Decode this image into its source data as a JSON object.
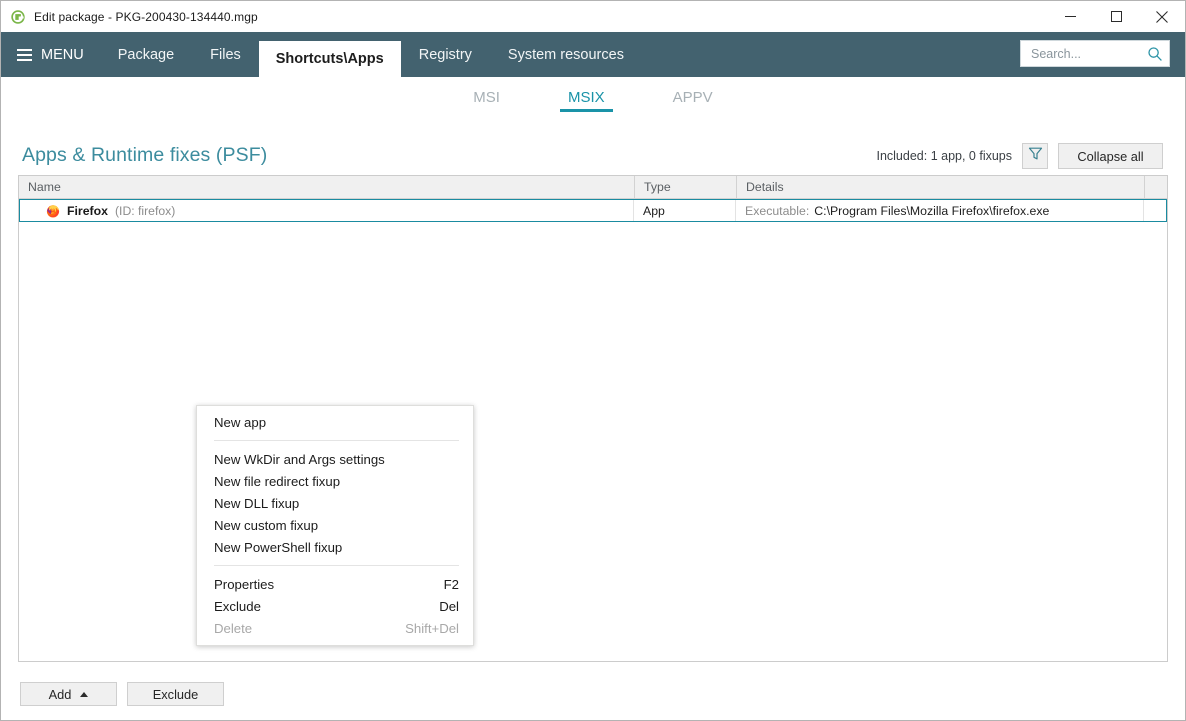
{
  "window": {
    "title": "Edit package - PKG-200430-134440.mgp",
    "app_icon": "package-logo-icon",
    "controls": {
      "minimize": "minimize-icon",
      "maximize": "maximize-icon",
      "close": "close-icon"
    }
  },
  "navbar": {
    "menu_label": "MENU",
    "tabs": [
      {
        "label": "Package",
        "active": false
      },
      {
        "label": "Files",
        "active": false
      },
      {
        "label": "Shortcuts\\Apps",
        "active": true
      },
      {
        "label": "Registry",
        "active": false
      },
      {
        "label": "System resources",
        "active": false
      }
    ],
    "search": {
      "placeholder": "Search...",
      "value": "",
      "icon": "search-icon"
    },
    "colors": {
      "bar_background": "#43626f",
      "active_tab_background": "#ffffff"
    }
  },
  "subtabs": [
    {
      "label": "MSI",
      "active": false
    },
    {
      "label": "MSIX",
      "active": true
    },
    {
      "label": "APPV",
      "active": false
    }
  ],
  "section": {
    "title": "Apps & Runtime fixes (PSF)",
    "included_text": "Included: 1 app, 0 fixups",
    "filter_icon": "funnel-filter-icon",
    "collapse_all_label": "Collapse all",
    "accent_color": "#3c8c9e"
  },
  "grid": {
    "columns": [
      "Name",
      "Type",
      "Details",
      ""
    ],
    "rows": [
      {
        "icon": "firefox-icon",
        "name": "Firefox",
        "id": "(ID: firefox)",
        "type": "App",
        "details_label": "Executable:",
        "details_value": "C:\\Program Files\\Mozilla Firefox\\firefox.exe",
        "selected": true
      }
    ],
    "selection_color": "#1a8ba0"
  },
  "context_menu": {
    "groups": [
      {
        "items": [
          {
            "label": "New app",
            "shortcut": "",
            "disabled": false
          }
        ]
      },
      {
        "items": [
          {
            "label": "New WkDir and Args settings",
            "shortcut": "",
            "disabled": false
          },
          {
            "label": "New file redirect fixup",
            "shortcut": "",
            "disabled": false
          },
          {
            "label": "New DLL fixup",
            "shortcut": "",
            "disabled": false
          },
          {
            "label": "New custom fixup",
            "shortcut": "",
            "disabled": false
          },
          {
            "label": "New PowerShell fixup",
            "shortcut": "",
            "disabled": false
          }
        ]
      },
      {
        "items": [
          {
            "label": "Properties",
            "shortcut": "F2",
            "disabled": false
          },
          {
            "label": "Exclude",
            "shortcut": "Del",
            "disabled": false
          },
          {
            "label": "Delete",
            "shortcut": "Shift+Del",
            "disabled": true
          }
        ]
      }
    ]
  },
  "footer": {
    "add_label": "Add",
    "add_caret": "caret-up-icon",
    "exclude_label": "Exclude"
  }
}
